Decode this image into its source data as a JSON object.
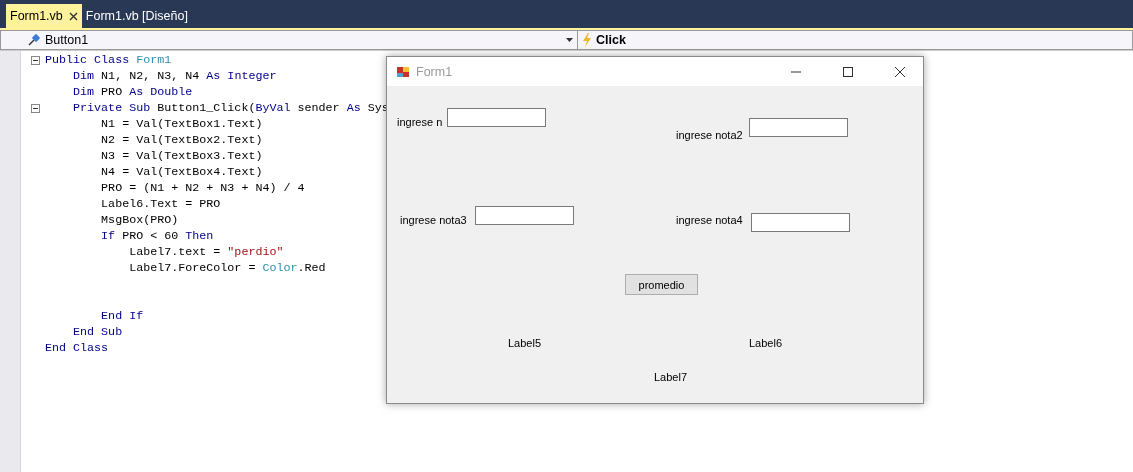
{
  "tabs": [
    {
      "label": "Form1.vb",
      "selected": true,
      "closable": true
    },
    {
      "label": "Form1.vb [Diseño]",
      "selected": false,
      "closable": false
    }
  ],
  "navigation": {
    "object": "Button1",
    "event": "Click"
  },
  "code": {
    "lines": [
      {
        "foldable": true,
        "tokens": [
          {
            "text": "Public Class ",
            "kind": "keyword"
          },
          {
            "text": "Form1",
            "kind": "type"
          }
        ]
      },
      {
        "foldable": false,
        "tokens": [
          {
            "text": "    Dim ",
            "kind": "keyword"
          },
          {
            "text": "N1, N2, N3, N4 ",
            "kind": "plain"
          },
          {
            "text": "As Integer",
            "kind": "keyword"
          }
        ]
      },
      {
        "foldable": false,
        "tokens": [
          {
            "text": "    Dim ",
            "kind": "keyword"
          },
          {
            "text": "PRO ",
            "kind": "plain"
          },
          {
            "text": "As Double",
            "kind": "keyword"
          }
        ]
      },
      {
        "foldable": true,
        "tokens": [
          {
            "text": "    Private Sub ",
            "kind": "keyword"
          },
          {
            "text": "Button1_Click(",
            "kind": "plain"
          },
          {
            "text": "ByVal ",
            "kind": "keyword"
          },
          {
            "text": "sender ",
            "kind": "plain"
          },
          {
            "text": "As ",
            "kind": "keyword"
          },
          {
            "text": "Sys",
            "kind": "plain"
          }
        ]
      },
      {
        "foldable": false,
        "tokens": [
          {
            "text": "        N1 = Val(TextBox1.Text)",
            "kind": "plain"
          }
        ]
      },
      {
        "foldable": false,
        "tokens": [
          {
            "text": "        N2 = Val(TextBox2.Text)",
            "kind": "plain"
          }
        ]
      },
      {
        "foldable": false,
        "tokens": [
          {
            "text": "        N3 = Val(TextBox3.Text)",
            "kind": "plain"
          }
        ]
      },
      {
        "foldable": false,
        "tokens": [
          {
            "text": "        N4 = Val(TextBox4.Text)",
            "kind": "plain"
          }
        ]
      },
      {
        "foldable": false,
        "tokens": [
          {
            "text": "        PRO = (N1 + N2 + N3 + N4) / 4",
            "kind": "plain"
          }
        ]
      },
      {
        "foldable": false,
        "tokens": [
          {
            "text": "        Label6.Text = PRO",
            "kind": "plain"
          }
        ]
      },
      {
        "foldable": false,
        "tokens": [
          {
            "text": "        MsgBox(PRO)",
            "kind": "plain"
          }
        ]
      },
      {
        "foldable": false,
        "tokens": [
          {
            "text": "        If ",
            "kind": "keyword"
          },
          {
            "text": "PRO < 60 ",
            "kind": "plain"
          },
          {
            "text": "Then",
            "kind": "keyword"
          }
        ]
      },
      {
        "foldable": false,
        "tokens": [
          {
            "text": "            Label7.text = ",
            "kind": "plain"
          },
          {
            "text": "\"perdio\"",
            "kind": "string"
          }
        ]
      },
      {
        "foldable": false,
        "tokens": [
          {
            "text": "            Label7.ForeColor = ",
            "kind": "plain"
          },
          {
            "text": "Color",
            "kind": "type"
          },
          {
            "text": ".Red",
            "kind": "plain"
          }
        ]
      },
      {
        "kind": "blank"
      },
      {
        "kind": "blank"
      },
      {
        "foldable": false,
        "tokens": [
          {
            "text": "        End If",
            "kind": "keyword"
          }
        ]
      },
      {
        "foldable": false,
        "tokens": [
          {
            "text": "    End Sub",
            "kind": "keyword"
          }
        ]
      },
      {
        "foldable": false,
        "tokens": [
          {
            "text": "End Class",
            "kind": "keyword"
          }
        ]
      }
    ]
  },
  "form_window": {
    "title": "Form1",
    "controls": [
      {
        "kind": "label",
        "text": "ingrese n"
      },
      {
        "kind": "textbox"
      },
      {
        "kind": "label",
        "text": "ingrese nota2"
      },
      {
        "kind": "textbox"
      },
      {
        "kind": "label",
        "text": "ingrese nota3"
      },
      {
        "kind": "textbox"
      },
      {
        "kind": "label",
        "text": "ingrese nota4"
      },
      {
        "kind": "textbox"
      },
      {
        "kind": "button",
        "text": "promedio"
      },
      {
        "kind": "label",
        "text": "Label5"
      },
      {
        "kind": "label",
        "text": "Label6"
      },
      {
        "kind": "label",
        "text": "Label7"
      }
    ]
  }
}
